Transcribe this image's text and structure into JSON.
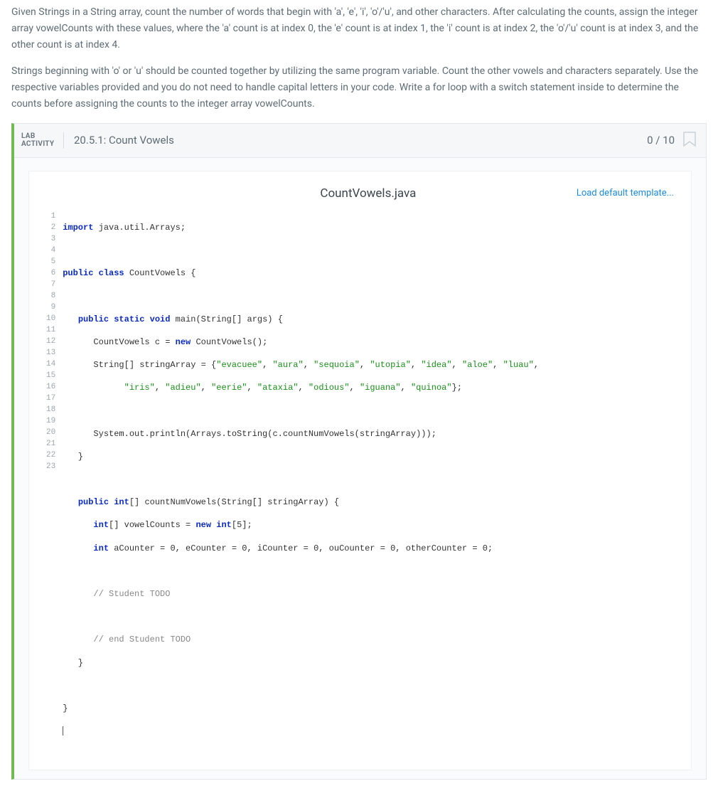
{
  "problem": {
    "para1": "Given Strings in a String array, count the number of words that begin with 'a', 'e', 'i', 'o'/'u', and other characters. After calculating the counts, assign the integer array vowelCounts with these values, where the 'a' count is at index 0, the 'e' count is at index 1, the 'i' count is at index 2, the 'o'/'u' count is at index 3, and the other count is at index 4.",
    "para2": "Strings beginning with 'o' or 'u' should be counted together by utilizing the same program variable. Count the other vowels and characters separately. Use the respective variables provided and you do not need to handle capital letters in your code. Write a for loop with a switch statement inside to determine the counts before assigning the counts to the integer array vowelCounts."
  },
  "lab": {
    "label_line1": "LAB",
    "label_line2": "ACTIVITY",
    "title": "20.5.1: Count Vowels",
    "score": "0 / 10"
  },
  "code": {
    "filename": "CountVowels.java",
    "load_template": "Load default template...",
    "line_count": 23
  }
}
